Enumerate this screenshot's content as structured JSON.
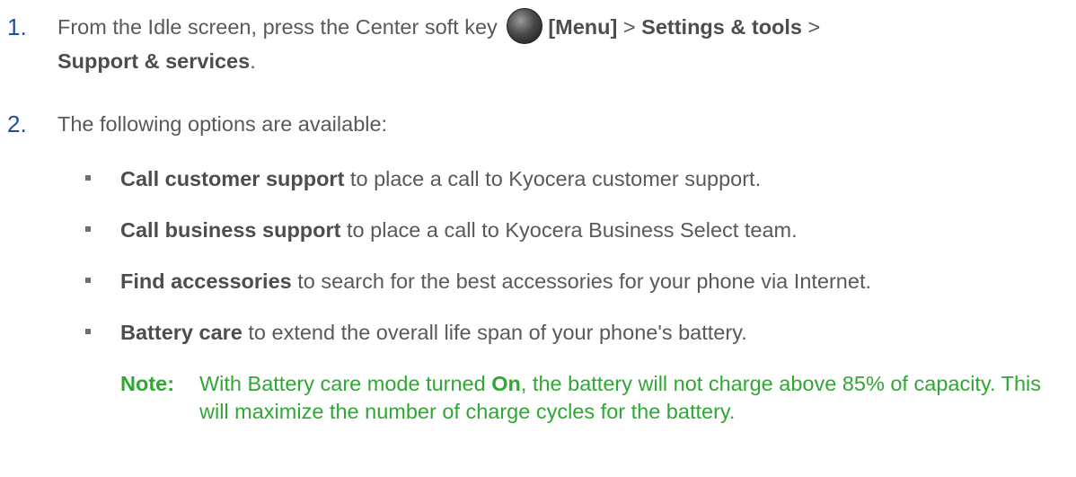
{
  "steps": [
    {
      "number": "1.",
      "pre": "From the Idle screen, press the Center soft key ",
      "key_label": "[Menu]",
      "sep1": " > ",
      "menu1": "Settings & tools",
      "sep2": " >",
      "menu2": "Support & services",
      "end": "."
    },
    {
      "number": "2.",
      "text": "The following options are available:"
    }
  ],
  "options": [
    {
      "term": "Call customer support",
      "desc": " to place a call to Kyocera customer support."
    },
    {
      "term": "Call business support",
      "desc": " to place a call to Kyocera Business Select team."
    },
    {
      "term": "Find accessories",
      "desc": " to search for the best accessories for your phone via Internet."
    },
    {
      "term": "Battery care",
      "desc": " to extend the overall life span of your phone's battery."
    }
  ],
  "note": {
    "label": "Note:",
    "pre": "With Battery care mode turned ",
    "bold": "On",
    "post": ", the battery will not charge above 85% of capacity. This will maximize the number of charge cycles for the battery."
  },
  "colors": {
    "body_text": "#595959",
    "step_number": "#1f4e9a",
    "note_text": "#2ea832"
  },
  "icons": {
    "center_soft_key": "center-soft-key-icon"
  }
}
